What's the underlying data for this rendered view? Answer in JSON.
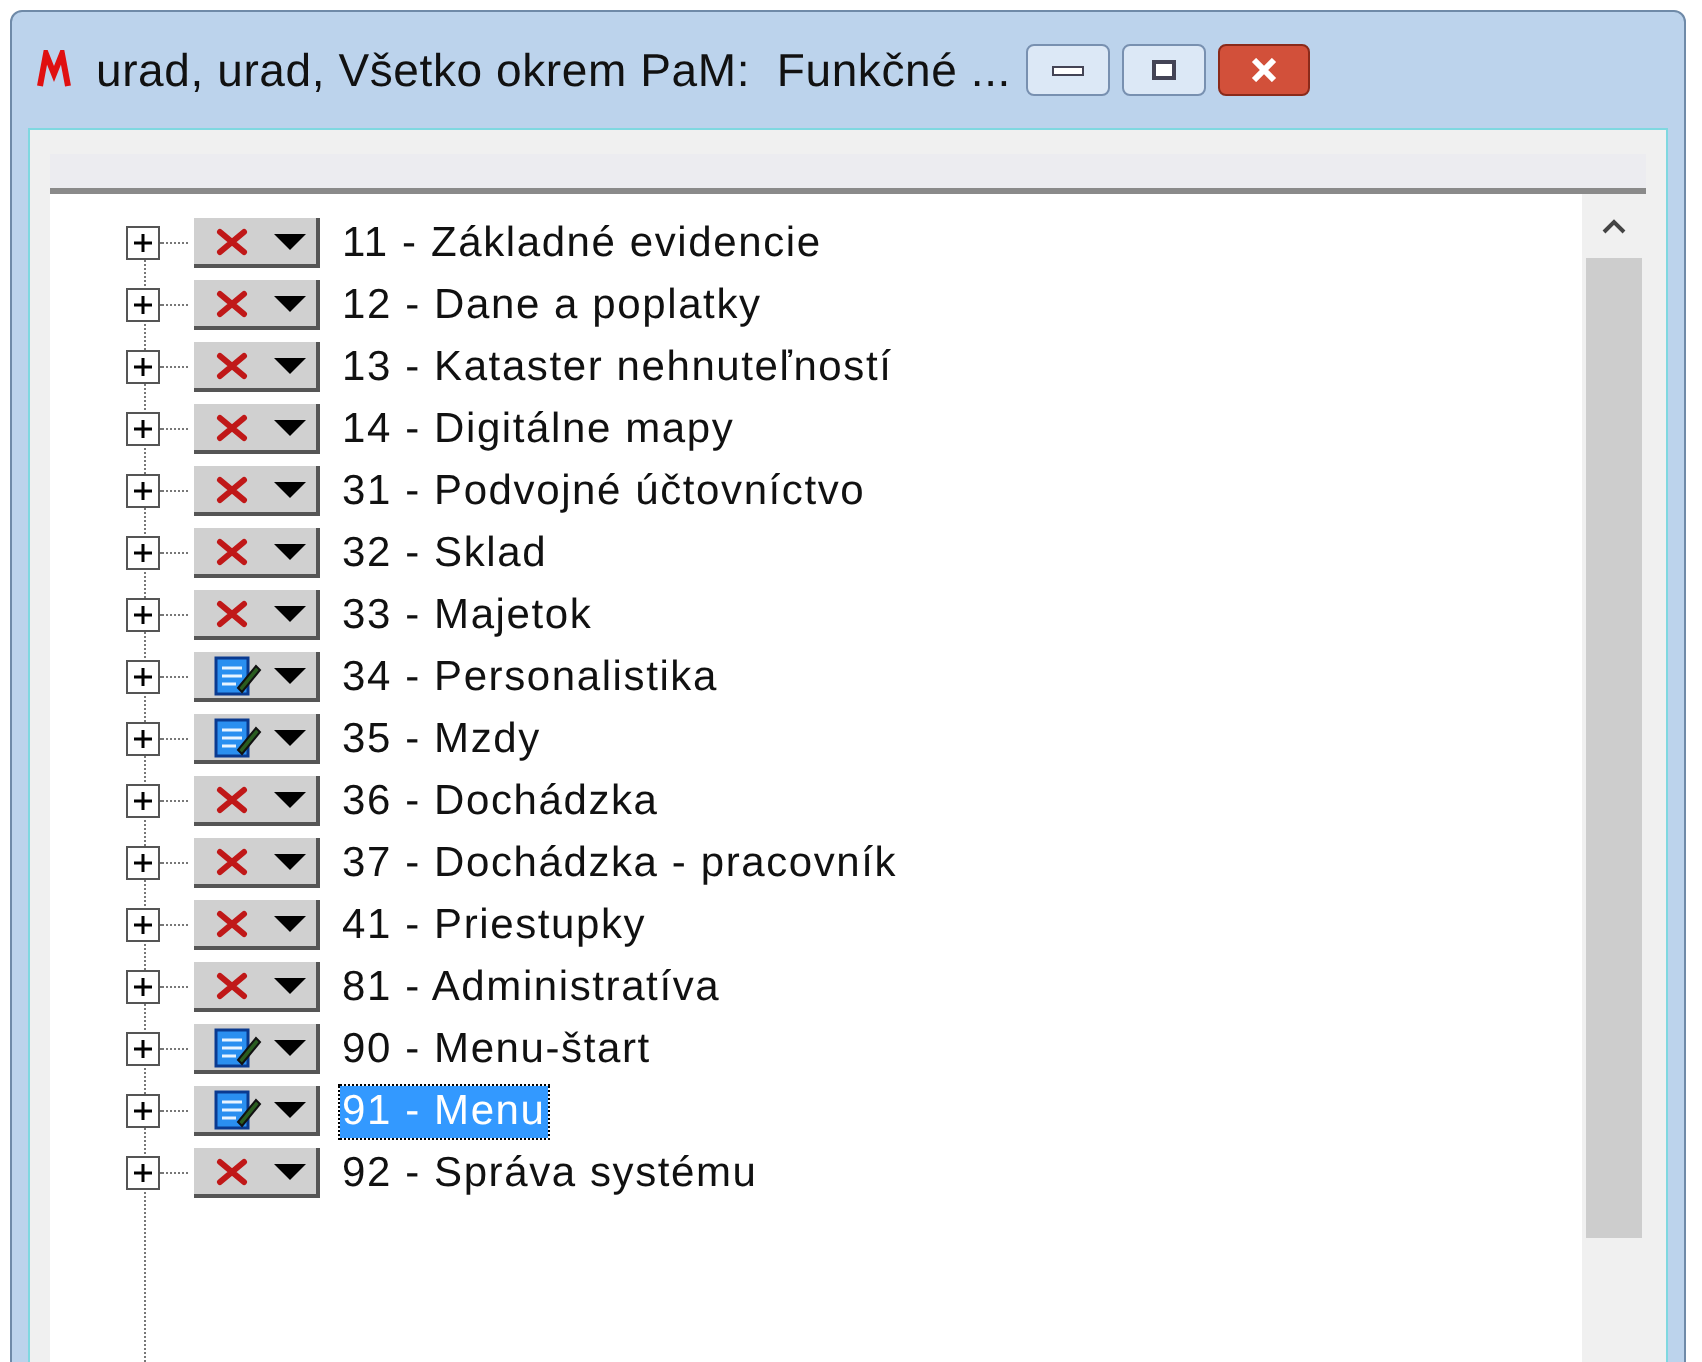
{
  "window": {
    "title": "urad, urad, Všetko okrem PaM:  Funkčné ..."
  },
  "tree": {
    "items": [
      {
        "label": "11 - Základné evidencie",
        "kind": "denied",
        "selected": false
      },
      {
        "label": "12 - Dane a poplatky",
        "kind": "denied",
        "selected": false
      },
      {
        "label": "13 - Kataster nehnuteľností",
        "kind": "denied",
        "selected": false
      },
      {
        "label": "14 - Digitálne mapy",
        "kind": "denied",
        "selected": false
      },
      {
        "label": "31 - Podvojné účtovníctvo",
        "kind": "denied",
        "selected": false
      },
      {
        "label": "32 - Sklad",
        "kind": "denied",
        "selected": false
      },
      {
        "label": "33 - Majetok",
        "kind": "denied",
        "selected": false
      },
      {
        "label": "34 - Personalistika",
        "kind": "edit",
        "selected": false
      },
      {
        "label": "35 - Mzdy",
        "kind": "edit",
        "selected": false
      },
      {
        "label": "36 - Dochádzka",
        "kind": "denied",
        "selected": false
      },
      {
        "label": "37 - Dochádzka - pracovník",
        "kind": "denied",
        "selected": false
      },
      {
        "label": "41 - Priestupky",
        "kind": "denied",
        "selected": false
      },
      {
        "label": "81 - Administratíva",
        "kind": "denied",
        "selected": false
      },
      {
        "label": "90 - Menu-štart",
        "kind": "edit",
        "selected": false
      },
      {
        "label": "91 - Menu",
        "kind": "edit",
        "selected": true
      },
      {
        "label": "92 - Správa systému",
        "kind": "denied",
        "selected": false
      }
    ]
  }
}
